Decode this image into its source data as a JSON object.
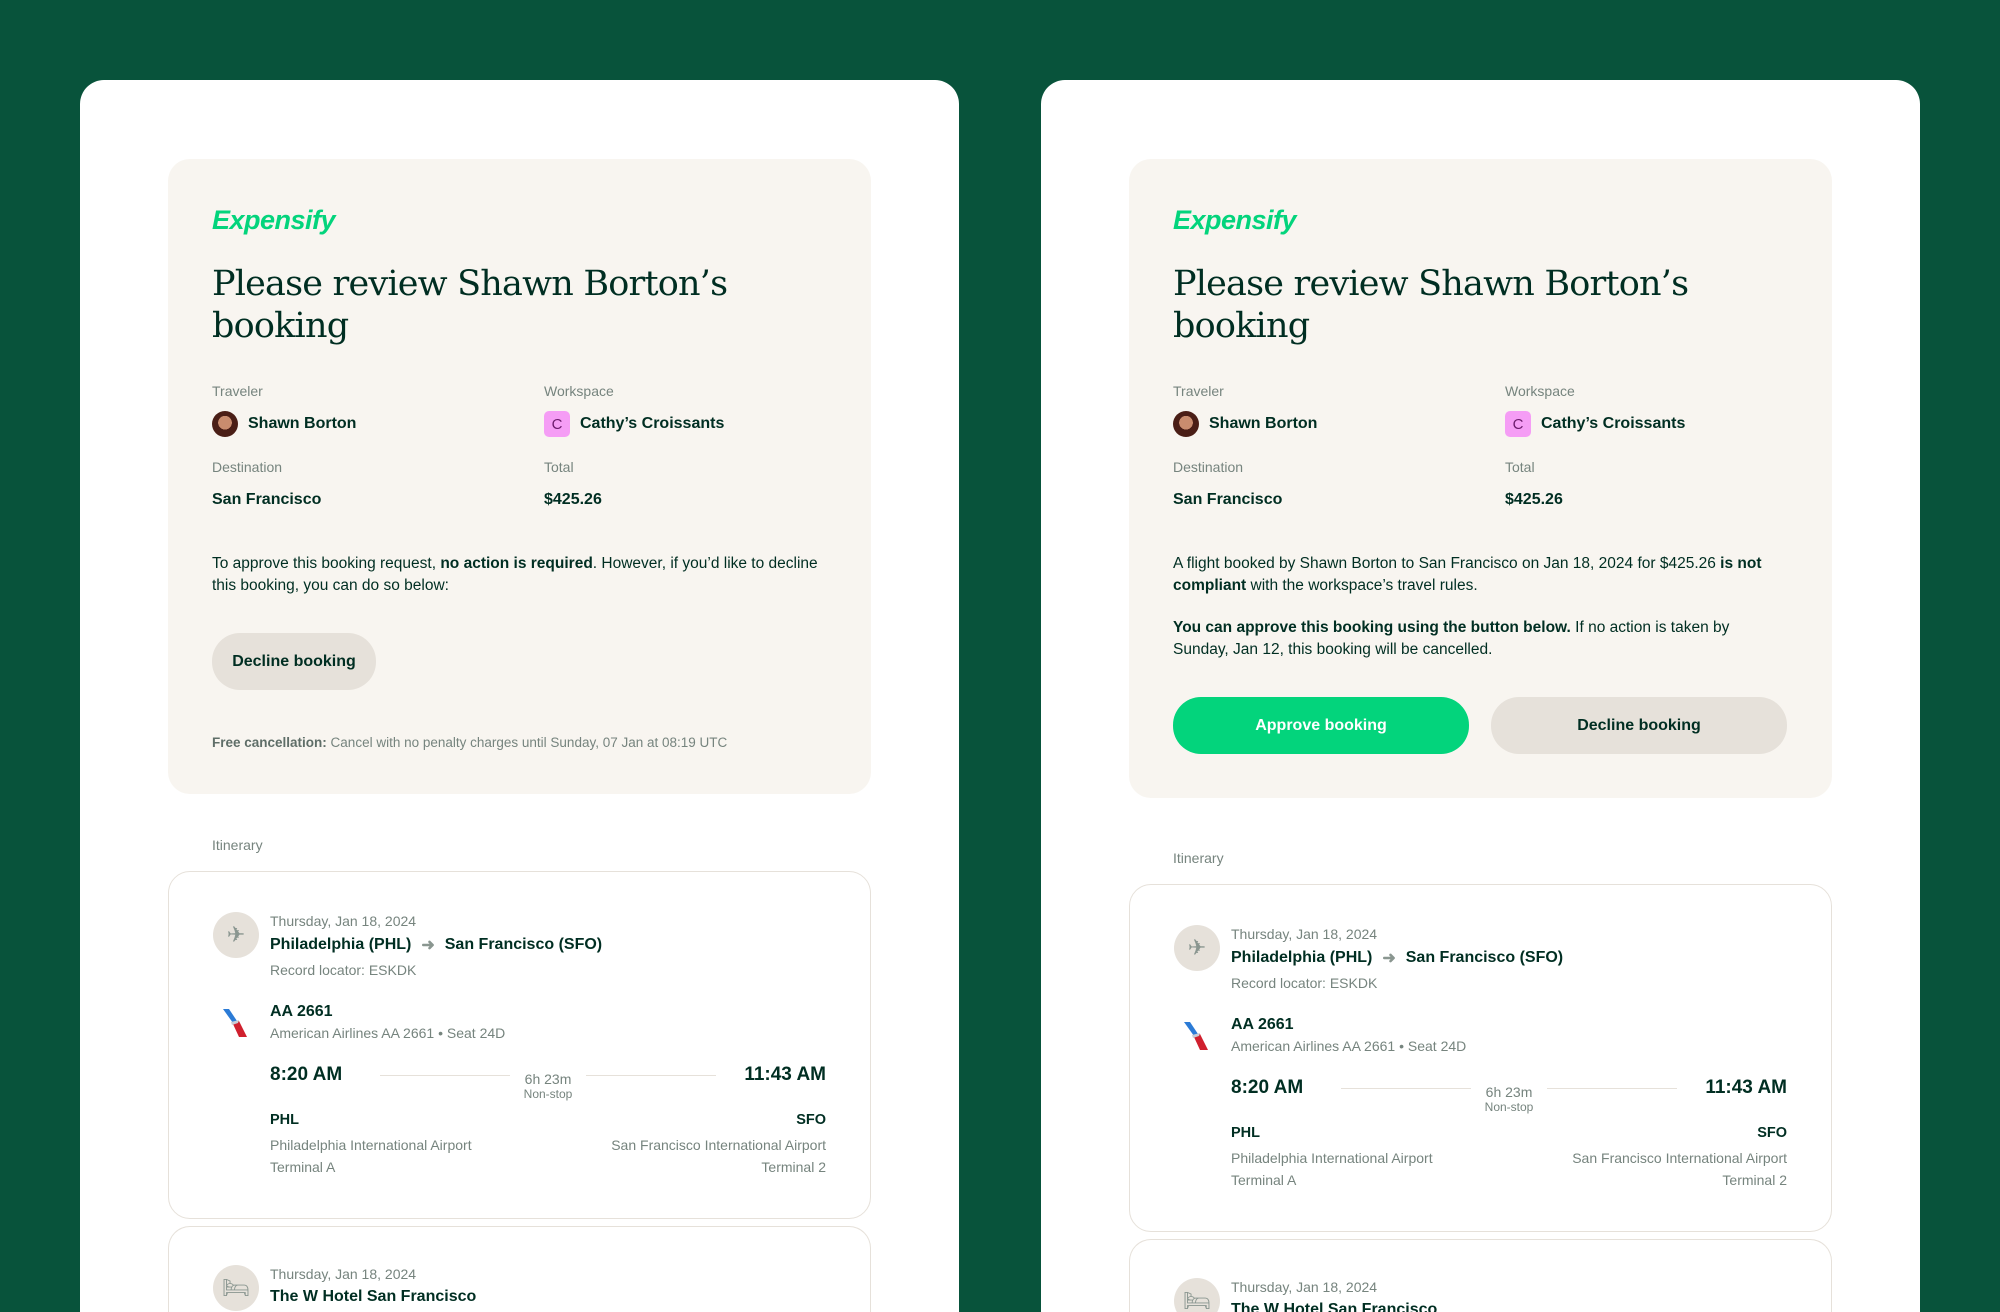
{
  "colors": {
    "background": "#08533b",
    "brand": "#03d47c",
    "card": "#f8f5f0",
    "workspace_badge": "#f59df5"
  },
  "left": {
    "logo": "Expensify",
    "title": "Please review Shawn Borton’s booking",
    "traveler_label": "Traveler",
    "traveler": "Shawn Borton",
    "workspace_label": "Workspace",
    "workspace_initial": "C",
    "workspace": "Cathy’s Croissants",
    "destination_label": "Destination",
    "destination": "San Francisco",
    "total_label": "Total",
    "total": "$425.26",
    "message": {
      "pre": "To approve this booking request, ",
      "bold": "no action is required",
      "post": ". However, if you’d like to decline this booking, you can do so below:"
    },
    "decline_label": "Decline booking",
    "note_bold": "Free cancellation:",
    "note": " Cancel with no penalty charges until Sunday, 07 Jan at 08:19 UTC"
  },
  "right": {
    "logo": "Expensify",
    "title": "Please review Shawn Borton’s booking",
    "traveler_label": "Traveler",
    "traveler": "Shawn Borton",
    "workspace_label": "Workspace",
    "workspace_initial": "C",
    "workspace": "Cathy’s Croissants",
    "destination_label": "Destination",
    "destination": "San Francisco",
    "total_label": "Total",
    "total": "$425.26",
    "message": {
      "pre": "A flight booked by Shawn Borton to San Francisco on Jan 18, 2024 for $425.26 ",
      "bold": "is not compliant",
      "post": " with the workspace’s travel rules."
    },
    "message2": {
      "bold": "You can approve this booking using the button below.",
      "post": " If no action is taken by Sunday, Jan 12, this booking will be cancelled."
    },
    "approve_label": "Approve booking",
    "decline_label": "Decline booking"
  },
  "itinerary": {
    "label": "Itinerary",
    "flight": {
      "date": "Thursday, Jan 18, 2024",
      "from": "Philadelphia (PHL)",
      "to": "San Francisco (SFO)",
      "record": "Record locator: ESKDK",
      "number": "AA 2661",
      "details": "American Airlines AA 2661 • Seat 24D",
      "dep_time": "8:20 AM",
      "arr_time": "11:43 AM",
      "duration": "6h 23m",
      "stops": "Non-stop",
      "dep_code": "PHL",
      "arr_code": "SFO",
      "dep_airport": "Philadelphia International Airport",
      "arr_airport": "San Francisco International Airport",
      "dep_terminal": "Terminal A",
      "arr_terminal": "Terminal 2",
      "icon": "airplane-icon"
    },
    "hotel": {
      "date": "Thursday, Jan 18, 2024",
      "name": "The W Hotel San Francisco",
      "icon": "bed-icon"
    }
  }
}
